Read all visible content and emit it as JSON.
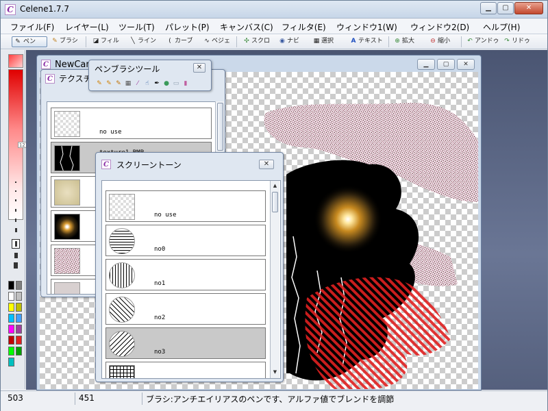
{
  "window": {
    "title": "Celene1.7.7",
    "icon": "app-logo-icon",
    "buttons": {
      "minimize": "▁",
      "maximize": "▢",
      "close": "✕"
    }
  },
  "menu": [
    "ファイル(F)",
    "レイヤー(L)",
    "ツール(T)",
    "パレット(P)",
    "キャンバス(C)",
    "フィルタ(E)",
    "ウィンドウ1(W)",
    "ウィンドウ2(D)",
    "ヘルプ(H)"
  ],
  "toolbar": [
    {
      "label": "ペン",
      "icon": "pen-icon",
      "glyph": "✎"
    },
    {
      "label": "ブラシ",
      "icon": "brush-icon",
      "glyph": "✎"
    },
    {
      "label": "フィル",
      "icon": "fill-icon",
      "glyph": "◪"
    },
    {
      "label": "ライン",
      "icon": "line-icon",
      "glyph": "╲"
    },
    {
      "label": "カーブ",
      "icon": "curve-icon",
      "glyph": "("
    },
    {
      "label": "ベジェ",
      "icon": "bezier-icon",
      "glyph": "∿"
    },
    {
      "label": "スクロ",
      "icon": "scroll-icon",
      "glyph": "✣"
    },
    {
      "label": "ナビ",
      "icon": "navigator-icon",
      "glyph": "◉"
    },
    {
      "label": "選択",
      "icon": "select-icon",
      "glyph": "▦"
    },
    {
      "label": "テキスト",
      "icon": "text-icon",
      "glyph": "A"
    },
    {
      "label": "拡大",
      "icon": "zoom-in-icon",
      "glyph": "⊕"
    },
    {
      "label": "縮小",
      "icon": "zoom-out-icon",
      "glyph": "⊖"
    },
    {
      "label": "アンドゥ",
      "icon": "undo-icon",
      "glyph": "↶"
    },
    {
      "label": "リドゥ",
      "icon": "redo-icon",
      "glyph": "↷"
    }
  ],
  "palette": {
    "slider_value": "121",
    "accent": "#e00000",
    "swatches": [
      "#000000",
      "#808080",
      "#ffffff",
      "#c0c0c0",
      "#ffff00",
      "#c0c000",
      "#00c0ff",
      "#40a0ff",
      "#ff00ff",
      "#a040a0",
      "#c00000",
      "#e02020",
      "#00ff00",
      "#00a000",
      "#00c0c0"
    ]
  },
  "canvas_window": {
    "title": "NewCan",
    "buttons": {
      "minimize": "▁",
      "maximize": "▢",
      "close": "✕"
    }
  },
  "texture_panel": {
    "title": "テクスチ",
    "items": [
      {
        "label": "no use",
        "thumb": "empty"
      },
      {
        "label": "texture1.BMP",
        "thumb": "cracks"
      },
      {
        "label": "",
        "thumb": "noise-beige"
      },
      {
        "label": "",
        "thumb": "glow"
      },
      {
        "label": "",
        "thumb": "noise-pink"
      },
      {
        "label": "",
        "thumb": "noise-grey"
      }
    ]
  },
  "brush_panel": {
    "title": "ペンブラシツール",
    "close": "✕",
    "tools": [
      "pencil-icon",
      "marker-icon",
      "airbrush-icon",
      "texture-icon",
      "dropper-icon",
      "smudge-icon",
      "pen-nib-icon",
      "bucket-icon",
      "eraser-icon",
      "paint-icon"
    ]
  },
  "screentone_panel": {
    "title": "スクリーントーン",
    "close": "✕",
    "items": [
      {
        "label": "no use",
        "pattern": "empty"
      },
      {
        "label": "no0",
        "pattern": "horizontal"
      },
      {
        "label": "no1",
        "pattern": "vertical"
      },
      {
        "label": "no2",
        "pattern": "diagonal-left"
      },
      {
        "label": "no3",
        "pattern": "diagonal-right",
        "selected": true
      },
      {
        "label": "",
        "pattern": "grid"
      }
    ]
  },
  "status": {
    "x": "503",
    "y": "451",
    "message": "ブラシ:アンチエイリアスのペンです、アルファ値でブレンドを調節"
  }
}
